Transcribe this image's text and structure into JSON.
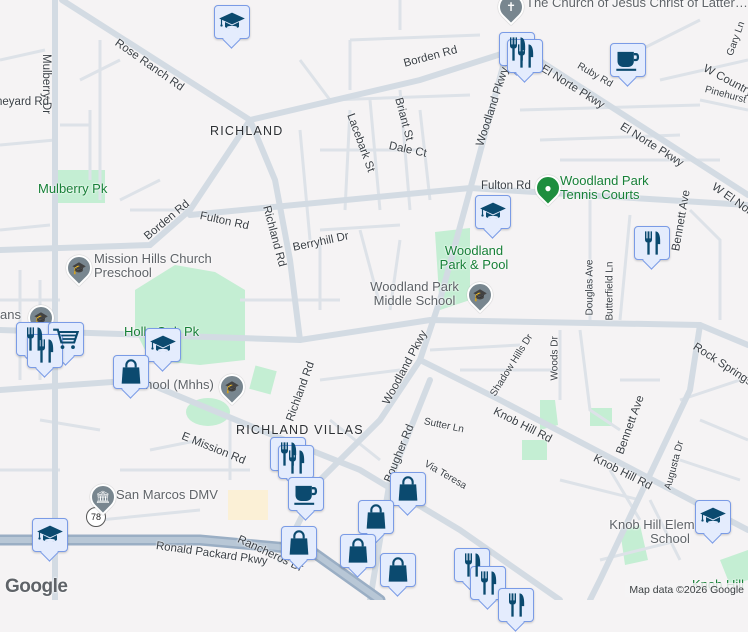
{
  "map": {
    "area_labels": [
      "RICHLAND",
      "RICHLAND VILLAS"
    ],
    "roads": {
      "rose_ranch": "Rose Ranch Rd",
      "borden_top": "Borden Rd",
      "borden_left": "Borden Rd",
      "mulberry": "Mulberry Dr",
      "vineyard": "Vineyard Rd",
      "richland_rd": "Richland Rd",
      "richland_rd_lower": "Richland Rd",
      "fulton_left": "Fulton Rd",
      "fulton_right": "Fulton Rd",
      "berryhill": "Berryhill Dr",
      "lacebark": "Lacebark St",
      "briant": "Briant St",
      "dale": "Dale Ct",
      "woodland_top": "Woodland Pkwy",
      "woodland_mid": "Woodland Pkwy",
      "el_norte": "El Norte Pkwy",
      "el_norte_2": "El Norte Pkwy",
      "w_el_norte": "W El Norte",
      "ruby": "Ruby Rd",
      "w_country": "W Country",
      "pinehurst": "Pinehurst",
      "gary": "Gary Ln",
      "bennett_top": "Bennett Ave",
      "bennett_low": "Bennett Ave",
      "douglas": "Douglas Ave",
      "butterfield": "Butterfield Ln",
      "rock_springs": "Rock Springs",
      "shadow_hills": "Shadow Hills Dr",
      "woods": "Woods Dr",
      "knob_hill_1": "Knob Hill Rd",
      "knob_hill_2": "Knob Hill Rd",
      "augusta": "Augusta Dr",
      "sutter": "Sutter Ln",
      "bougher": "Bougher Rd",
      "via_teresa": "Via Teresa",
      "e_mission": "E Mission Rd",
      "ronald_packard": "Ronald Packard Pkwy",
      "rancheros": "Rancheros Dr",
      "hwy": "78"
    },
    "places": {
      "church": "The Church of Jesus Christ of Latter…",
      "tennis": "Woodland Park Tennis Courts",
      "woodland_pool": "Woodland Park & Pool",
      "woodland_ms": "Woodland Park Middle School",
      "mulberry_pk": "Mulberry Pk",
      "mission_preschool": "Mission Hills Church Preschool",
      "holly_pk": "Holly Oak Pk",
      "mhhs": "School (Mhhs)",
      "dmv": "San Marcos DMV",
      "knob_hill_es": "Knob Hill Elementary School",
      "knob_hill_park": "Knob Hill",
      "left_partial": "ans"
    },
    "markers": [
      "school",
      "restaurant",
      "restaurant",
      "coffee",
      "school",
      "restaurant",
      "restaurant",
      "restaurant",
      "cart",
      "school",
      "bag",
      "restaurant",
      "restaurant",
      "coffee",
      "bag",
      "bag",
      "bag",
      "bag",
      "bag",
      "school",
      "restaurant",
      "restaurant",
      "restaurant",
      "school"
    ],
    "icon_color": "#0b4a6f",
    "marker_bg": "#e4ecfd",
    "park_color": "#c4eed3"
  },
  "footer": {
    "logo": "Google",
    "attribution": "Map data ©2026 Google"
  }
}
